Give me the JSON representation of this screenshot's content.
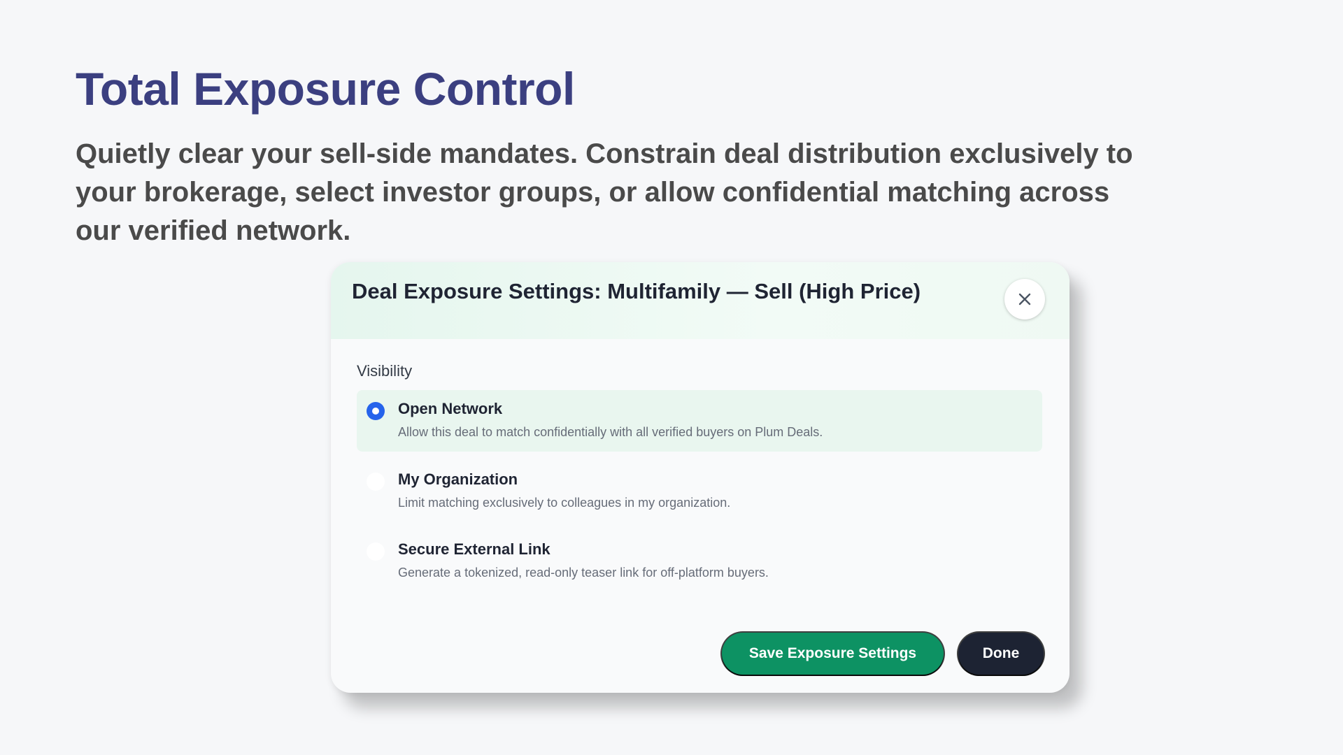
{
  "hero": {
    "title": "Total Exposure Control",
    "subtitle": "Quietly clear your sell-side mandates. Constrain deal distribution exclusively to your brokerage, select investor groups, or allow confidential matching across our verified network."
  },
  "modal": {
    "title": "Deal Exposure Settings: Multifamily — Sell (High Price)",
    "close_icon": "close-icon",
    "section_label": "Visibility",
    "options": [
      {
        "label": "Open Network",
        "description": "Allow this deal to match confidentially with all verified buyers on Plum Deals.",
        "selected": true
      },
      {
        "label": "My Organization",
        "description": "Limit matching exclusively to colleagues in my organization.",
        "selected": false
      },
      {
        "label": "Secure External Link",
        "description": "Generate a tokenized, read-only teaser link for off-platform buyers.",
        "selected": false
      }
    ],
    "save_label": "Save Exposure Settings",
    "done_label": "Done"
  },
  "colors": {
    "title": "#3b3f80",
    "accent_green": "#0d9263",
    "radio_selected": "#2563eb",
    "dark_button": "#1d2333",
    "header_tint": "#e5f6ee"
  }
}
